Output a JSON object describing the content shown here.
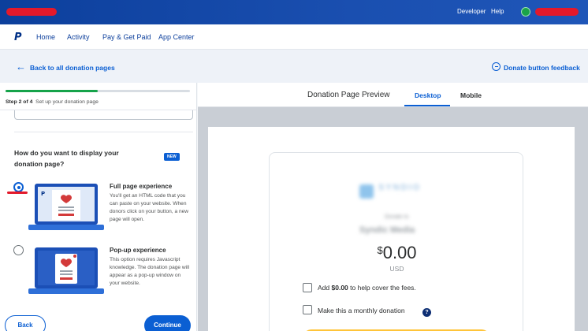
{
  "topbar": {
    "developer_label": "Developer",
    "help_label": "Help"
  },
  "nav": {
    "logo_text": "P",
    "items": [
      "Home",
      "Activity",
      "Pay & Get Paid",
      "App Center"
    ]
  },
  "backbar": {
    "back_label": "Back to all donation pages",
    "feedback_label": "Donate button feedback"
  },
  "wizard": {
    "progress": 0.5,
    "step_prefix": "Step 2 of 4",
    "step_title": "Set up your donation page",
    "question": "How do you want to display your donation page?",
    "new_badge": "NEW",
    "options": [
      {
        "title": "Full page experience",
        "description": "You'll get an HTML code that you can paste on your website. When donors click on your button, a new page will open.",
        "selected": true
      },
      {
        "title": "Pop-up experience",
        "description": "This option requires Javascript knowledge. The donation page will appear as a pop-up window on your website.",
        "selected": false
      }
    ],
    "back_button": "Back",
    "continue_button": "Continue"
  },
  "preview": {
    "title": "Donation Page Preview",
    "tabs": [
      {
        "label": "Desktop",
        "active": true
      },
      {
        "label": "Mobile",
        "active": false
      }
    ],
    "currency_symbol": "$",
    "amount": "0.00",
    "currency": "USD",
    "cover_fees_prefix": "Add ",
    "cover_fees_amount": "$0.00",
    "cover_fees_suffix": " to help cover the fees.",
    "monthly_label": "Make this a monthly donation",
    "help_icon_glyph": "?"
  },
  "colors": {
    "brand_blue": "#0b5fd3",
    "topbar_blue": "#0c3f9c",
    "progress_green": "#16a34a",
    "donate_yellow": "#ffc439",
    "redaction_red": "#e3192b"
  }
}
